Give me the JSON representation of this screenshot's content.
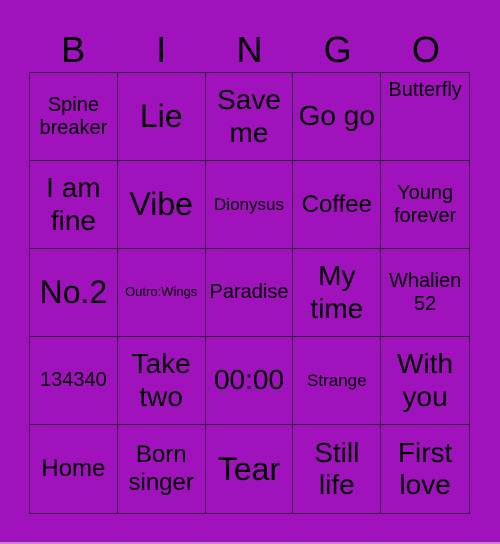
{
  "header": {
    "letters": [
      "B",
      "I",
      "N",
      "G",
      "O"
    ]
  },
  "colors": {
    "background": "#A012BC",
    "grid_line": "#3A0A45",
    "text": "#000000"
  },
  "cells": [
    [
      "Spine breaker",
      "Lie",
      "Save me",
      "Go go",
      "Butterfly"
    ],
    [
      "I am fine",
      "Vibe",
      "Dionysus",
      "Coffee",
      "Young forever"
    ],
    [
      "No.2",
      "Outro:Wings",
      "Paradise",
      "My time",
      "Whalien 52"
    ],
    [
      "134340",
      "Take two",
      "00:00",
      "Strange",
      "With you"
    ],
    [
      "Home",
      "Born singer",
      "Tear",
      "Still life",
      "First love"
    ]
  ]
}
